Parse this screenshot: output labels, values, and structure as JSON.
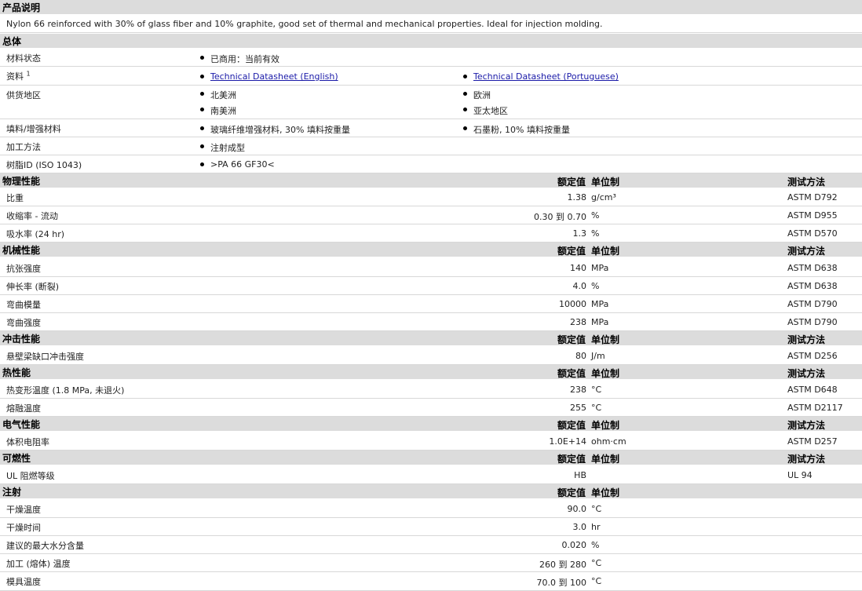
{
  "desc_section": {
    "title": "产品说明"
  },
  "description": "Nylon 66 reinforced with 30% of glass fiber and 10% graphite, good set of thermal and mechanical properties. Ideal for injection molding.",
  "general": {
    "title": "总体",
    "material_status": {
      "label": "材料状态",
      "value": "已商用：当前有效"
    },
    "datasheets": {
      "label": "资料",
      "note": "1",
      "links": [
        "Technical Datasheet (English)",
        "Technical Datasheet (Portuguese)"
      ]
    },
    "availability": {
      "label": "供货地区",
      "items": [
        "北美洲",
        "欧洲",
        "南美洲",
        "亚太地区"
      ]
    },
    "filler": {
      "label": "填料/增强材料",
      "items": [
        "玻璃纤维增强材料, 30% 填料按重量",
        "石墨粉, 10% 填料按重量"
      ]
    },
    "processing": {
      "label": "加工方法",
      "value": "注射成型"
    },
    "resin_id": {
      "label": "树脂ID (ISO 1043)",
      "value": ">PA 66 GF30<"
    }
  },
  "headers": {
    "nominal": "额定值",
    "unit": "单位制",
    "method": "测试方法"
  },
  "sections": [
    {
      "title": "物理性能",
      "rows": [
        {
          "label": "比重",
          "value": "1.38",
          "unit": "g/cm³",
          "method": "ASTM D792"
        },
        {
          "label": "收缩率 - 流动",
          "value": "0.30 到  0.70",
          "unit": "%",
          "method": "ASTM D955"
        },
        {
          "label": "吸水率 (24 hr)",
          "value": "1.3",
          "unit": "%",
          "method": "ASTM D570"
        }
      ]
    },
    {
      "title": "机械性能",
      "rows": [
        {
          "label": "抗张强度",
          "value": "140",
          "unit": "MPa",
          "method": "ASTM D638"
        },
        {
          "label": "伸长率 (断裂)",
          "value": "4.0",
          "unit": "%",
          "method": "ASTM D638"
        },
        {
          "label": "弯曲模量",
          "value": "10000",
          "unit": "MPa",
          "method": "ASTM D790"
        },
        {
          "label": "弯曲强度",
          "value": "238",
          "unit": "MPa",
          "method": "ASTM D790"
        }
      ]
    },
    {
      "title": "冲击性能",
      "rows": [
        {
          "label": "悬壁梁缺口冲击强度",
          "value": "80",
          "unit": "J/m",
          "method": "ASTM D256"
        }
      ]
    },
    {
      "title": "热性能",
      "rows": [
        {
          "label": "热变形温度 (1.8 MPa, 未退火)",
          "value": "238",
          "unit": "°C",
          "method": "ASTM D648"
        },
        {
          "label": "熔融温度",
          "value": "255",
          "unit": "°C",
          "method": "ASTM D2117"
        }
      ]
    },
    {
      "title": "电气性能",
      "rows": [
        {
          "label": "体积电阻率",
          "value": "1.0E+14",
          "unit": "ohm·cm",
          "method": "ASTM D257"
        }
      ]
    },
    {
      "title": "可燃性",
      "rows": [
        {
          "label": "UL 阻燃等级",
          "value": "HB",
          "unit": "",
          "method": "UL 94"
        }
      ]
    },
    {
      "title": "注射",
      "no_method": true,
      "rows": [
        {
          "label": "干燥温度",
          "value": "90.0",
          "unit": "°C",
          "method": ""
        },
        {
          "label": "干燥时间",
          "value": "3.0",
          "unit": "hr",
          "method": ""
        },
        {
          "label": "建议的最大水分含量",
          "value": "0.020",
          "unit": "%",
          "method": ""
        },
        {
          "label": "加工 (熔体) 温度",
          "value": "260 到  280",
          "unit": "°C",
          "method": ""
        },
        {
          "label": "模具温度",
          "value": "70.0 到  100",
          "unit": "°C",
          "method": ""
        }
      ]
    }
  ]
}
